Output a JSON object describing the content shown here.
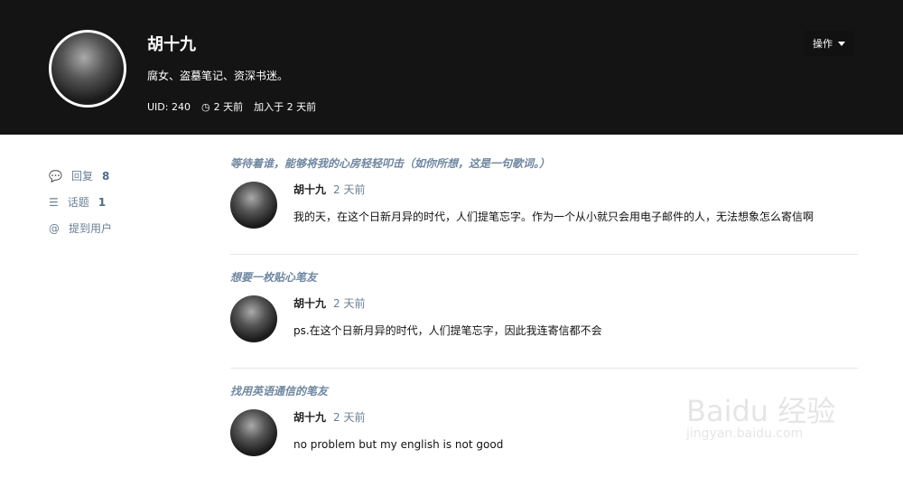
{
  "profile": {
    "name": "胡十九",
    "bio": "腐女、盗墓笔记、资深书迷。",
    "uid": "UID: 240",
    "last_seen": "2 天前",
    "joined": "加入于 2 天前",
    "ops_label": "操作"
  },
  "nav": [
    {
      "label": "回复",
      "count": "8"
    },
    {
      "label": "话题",
      "count": "1"
    },
    {
      "label": "提到用户",
      "count": ""
    }
  ],
  "posts": [
    {
      "title": "等待着谁，能够将我的心房轻轻叩击（如你所想，这是一句歌词。）",
      "author": "胡十九",
      "time": "2 天前",
      "body": "我的天，在这个日新月异的时代，人们提笔忘字。作为一个从小就只会用电子邮件的人，无法想象怎么寄信啊"
    },
    {
      "title": "想要一枚贴心笔友",
      "author": "胡十九",
      "time": "2 天前",
      "body": "ps.在这个日新月异的时代，人们提笔忘字，因此我连寄信都不会"
    },
    {
      "title": "找用英语通信的笔友",
      "author": "胡十九",
      "time": "2 天前",
      "body": "no problem but my english is not good"
    }
  ],
  "watermark": {
    "title": "Baidu 经验",
    "sub": "jingyan.baidu.com"
  }
}
